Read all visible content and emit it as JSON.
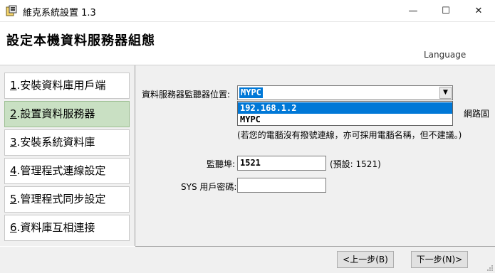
{
  "window": {
    "title": "維克系統設置 1.3",
    "min_glyph": "—",
    "max_glyph": "☐",
    "close_glyph": "✕"
  },
  "header": {
    "title": "設定本機資料服務器組態",
    "language": "Language"
  },
  "nav": [
    {
      "num": "1",
      "label": ".安裝資料庫用戶端",
      "active": false
    },
    {
      "num": "2",
      "label": ".設置資料服務器",
      "active": true
    },
    {
      "num": "3",
      "label": ".安裝系統資料庫",
      "active": false
    },
    {
      "num": "4",
      "label": ".管理程式連線設定",
      "active": false
    },
    {
      "num": "5",
      "label": ".管理程式同步設定",
      "active": false
    },
    {
      "num": "6",
      "label": ".資料庫互相連接",
      "active": false
    }
  ],
  "form": {
    "location_label": "資料服務器監聽器位置:",
    "location_value": "MYPC",
    "location_options": [
      "192.168.1.2",
      "MYPC"
    ],
    "hint_right": "網路固",
    "hint_line2": "(若您的電腦沒有撥號連線，亦可採用電腦名稱，但不建議。)",
    "port_label": "監聽埠:",
    "port_value": "1521",
    "port_default": "(預設: 1521)",
    "sys_password_label": "SYS 用戶密碼:",
    "sys_password_value": ""
  },
  "buttons": {
    "prev": "<上一步(B)",
    "next": "下一步(N)>"
  },
  "colors": {
    "accent": "#0078d7",
    "nav_active": "#c9e0c3"
  }
}
